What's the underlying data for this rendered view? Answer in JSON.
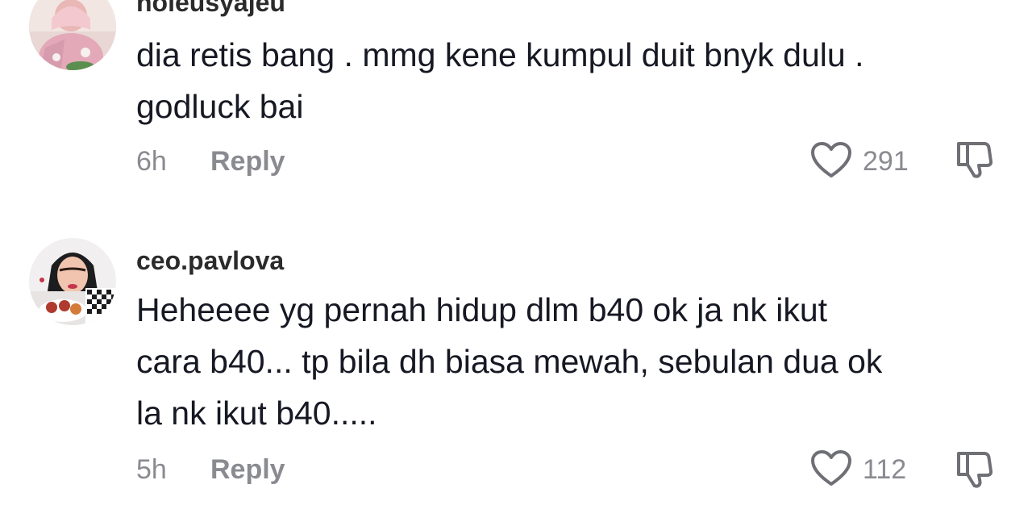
{
  "comments": [
    {
      "username": "noleusyajeu",
      "text_lines": [
        "dia retis bang . mmg kene kumpul duit bnyk dulu .",
        "godluck bai"
      ],
      "time": "6h",
      "reply_label": "Reply",
      "likes": "291",
      "avatar_icon": "user-avatar-pink-outfit",
      "like_icon": "heart-outline-icon",
      "dislike_icon": "thumbs-down-icon"
    },
    {
      "username": "ceo.pavlova",
      "text_lines": [
        "Heheeee yg pernah hidup dlm b40 ok ja nk ikut",
        "cara b40... tp bila dh biasa mewah, sebulan dua ok",
        "la nk ikut b40....."
      ],
      "time": "5h",
      "reply_label": "Reply",
      "likes": "112",
      "avatar_icon": "user-avatar-hijab-cakes",
      "like_icon": "heart-outline-icon",
      "dislike_icon": "thumbs-down-icon"
    }
  ],
  "colors": {
    "primary_text": "#161823",
    "secondary_text": "#8a8b91",
    "icon_stroke": "#6f7075",
    "background": "#ffffff"
  }
}
